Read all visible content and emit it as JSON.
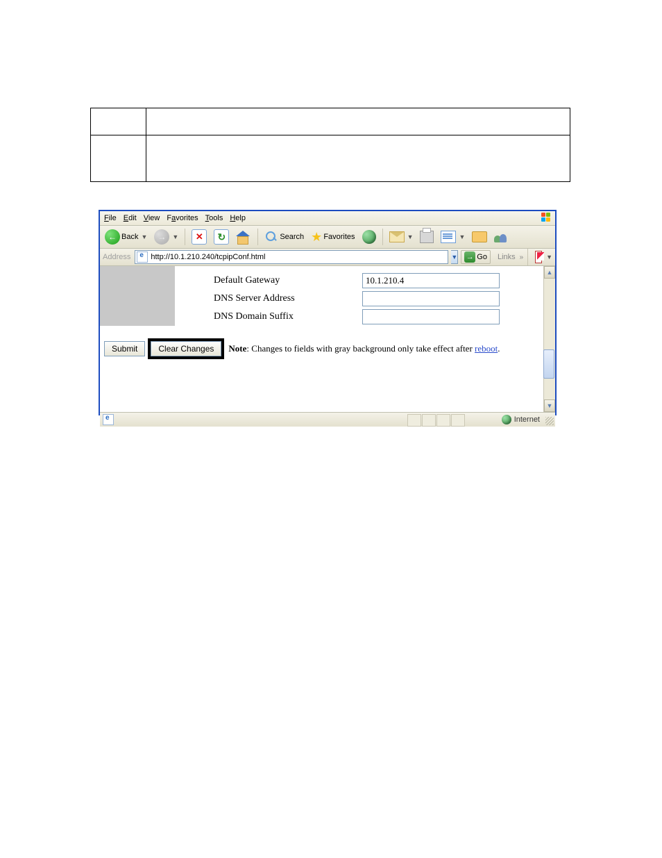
{
  "menubar": {
    "file": "File",
    "edit": "Edit",
    "view": "View",
    "favorites": "Favorites",
    "tools": "Tools",
    "help": "Help"
  },
  "toolbar": {
    "back": "Back",
    "search": "Search",
    "favorites": "Favorites"
  },
  "addressbar": {
    "label": "Address",
    "url": "http://10.1.210.240/tcpipConf.html",
    "go": "Go",
    "links": "Links"
  },
  "form": {
    "gateway_label": "Default Gateway",
    "gateway_value": "10.1.210.4",
    "dns_label": "DNS Server Address",
    "dns_value": "",
    "suffix_label": "DNS Domain Suffix",
    "suffix_value": "",
    "submit": "Submit",
    "clear": "Clear Changes",
    "note_bold": "Note",
    "note_text": ": Changes to fields with gray background only take effect after ",
    "note_link": "reboot",
    "note_end": "."
  },
  "statusbar": {
    "zone": "Internet"
  }
}
